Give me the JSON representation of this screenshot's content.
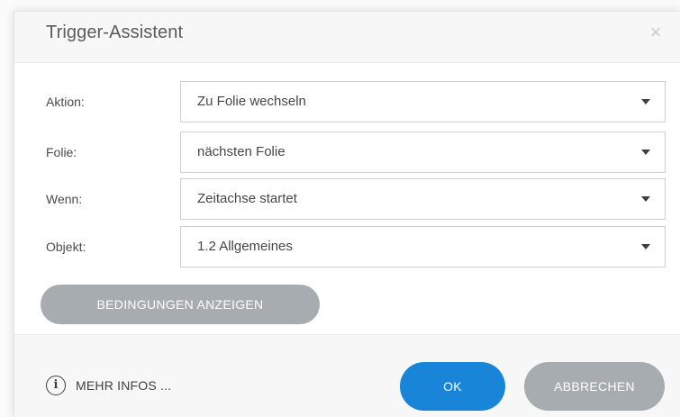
{
  "dialog": {
    "title": "Trigger-Assistent",
    "close_glyph": "×"
  },
  "form": {
    "rows": [
      {
        "label": "Aktion:",
        "value": "Zu Folie wechseln"
      },
      {
        "label": "Folie:",
        "value": "nächsten Folie"
      },
      {
        "label": "Wenn:",
        "value": "Zeitachse startet"
      },
      {
        "label": "Objekt:",
        "value": "1.2 Allgemeines"
      }
    ]
  },
  "conditions_button": {
    "label": "BEDINGUNGEN ANZEIGEN"
  },
  "footer": {
    "more_info": {
      "icon_glyph": "i",
      "label": "MEHR INFOS ..."
    },
    "ok_label": "OK",
    "cancel_label": "ABBRECHEN"
  },
  "colors": {
    "primary": "#1985d8",
    "secondary_button": "#a6acb0",
    "header_bg": "#f7f7f8"
  },
  "icons": [
    "close-icon",
    "info-icon",
    "chevron-down-icon"
  ]
}
